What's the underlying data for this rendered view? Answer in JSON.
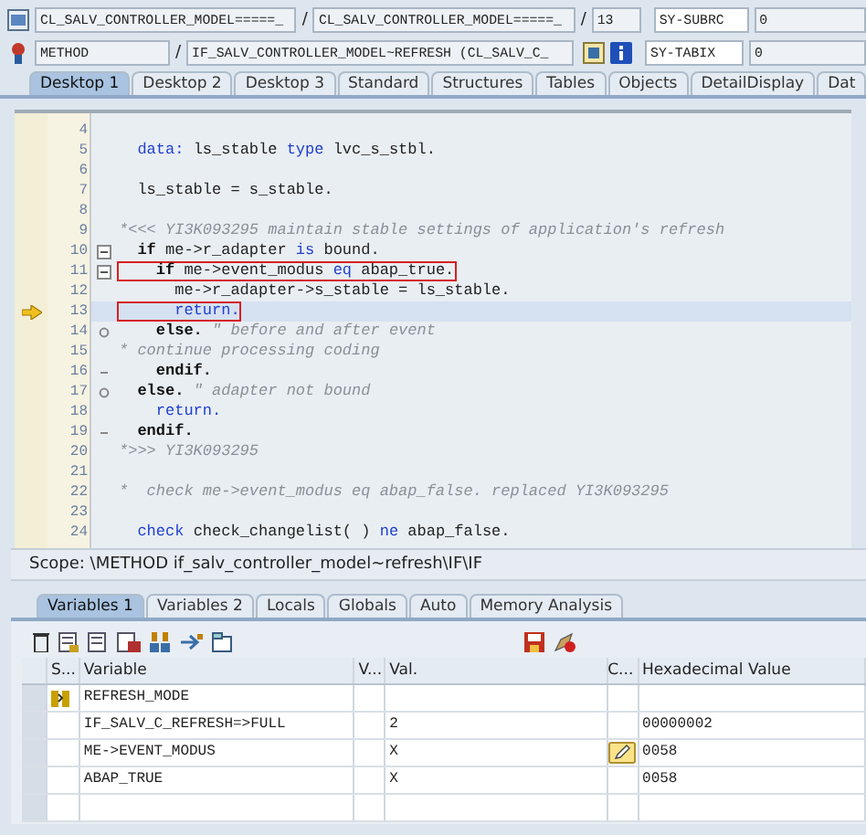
{
  "header": {
    "rows": [
      {
        "fields": [
          {
            "kind": "field",
            "value": "CL_SALV_CONTROLLER_MODEL=====_"
          },
          {
            "kind": "separator",
            "value": "/"
          },
          {
            "kind": "field",
            "value": "CL_SALV_CONTROLLER_MODEL=====_"
          },
          {
            "kind": "separator",
            "value": "/"
          },
          {
            "kind": "field",
            "value": "13"
          }
        ],
        "sys_field": "SY-SUBRC",
        "sys_value": "0",
        "tools": false
      },
      {
        "fields": [
          {
            "kind": "field",
            "value": "METHOD"
          },
          {
            "kind": "separator",
            "value": "/"
          },
          {
            "kind": "field",
            "value": "IF_SALV_CONTROLLER_MODEL~REFRESH (CL_SALV_C_"
          }
        ],
        "sys_field": "SY-TABIX",
        "sys_value": "0",
        "tools": true
      }
    ]
  },
  "tabs": [
    {
      "label": "Desktop 1",
      "selected": true
    },
    {
      "label": "Desktop 2",
      "selected": false
    },
    {
      "label": "Desktop 3",
      "selected": false
    },
    {
      "label": "Standard",
      "selected": false
    },
    {
      "label": "Structures",
      "selected": false
    },
    {
      "label": "Tables",
      "selected": false
    },
    {
      "label": "Objects",
      "selected": false
    },
    {
      "label": "DetailDisplay",
      "selected": false
    },
    {
      "label": "Dat",
      "selected": false
    }
  ],
  "code": {
    "lines": [
      {
        "number": "4",
        "current": false,
        "highlighted": false
      },
      {
        "number": "5",
        "current": false,
        "highlighted": false,
        "tokens": [
          {
            "kind": "keyword",
            "text": "  data:"
          },
          {
            "kind": "plain",
            "text": " ls_stable "
          },
          {
            "kind": "keyword",
            "text": "type"
          },
          {
            "kind": "plain",
            "text": " lvc_s_stbl."
          }
        ]
      },
      {
        "number": "6",
        "current": false,
        "highlighted": false
      },
      {
        "number": "7",
        "current": false,
        "highlighted": false,
        "tokens": [
          {
            "kind": "plain",
            "text": "  ls_stable = s_stable."
          }
        ]
      },
      {
        "number": "8",
        "current": false,
        "highlighted": false
      },
      {
        "number": "9",
        "current": false,
        "highlighted": false,
        "tokens": [
          {
            "kind": "comment",
            "text": "*<<< YI3K093295 maintain stable settings of application's refresh"
          }
        ]
      },
      {
        "number": "10",
        "current": false,
        "highlighted": false,
        "fold": {
          "kind": "box"
        },
        "tokens": [
          {
            "kind": "control",
            "text": "  if"
          },
          {
            "kind": "plain",
            "text": " me->r_adapter "
          },
          {
            "kind": "keyword",
            "text": "is"
          },
          {
            "kind": "plain",
            "text": " bound."
          }
        ]
      },
      {
        "number": "11",
        "current": false,
        "highlighted": true,
        "fold": {
          "kind": "box"
        },
        "tokens": [
          {
            "kind": "control",
            "text": "    if"
          },
          {
            "kind": "plain",
            "text": " me->event_modus "
          },
          {
            "kind": "keyword",
            "text": "eq"
          },
          {
            "kind": "plain",
            "text": " abap_true."
          }
        ]
      },
      {
        "number": "12",
        "current": false,
        "highlighted": false,
        "tokens": [
          {
            "kind": "plain",
            "text": "      me->r_adapter->s_stable = ls_stable."
          }
        ]
      },
      {
        "number": "13",
        "current": true,
        "highlighted": true,
        "tokens": [
          {
            "kind": "keyword",
            "text": "      return."
          }
        ]
      },
      {
        "number": "14",
        "current": false,
        "highlighted": false,
        "fold": {
          "kind": "dot"
        },
        "tokens": [
          {
            "kind": "control",
            "text": "    else."
          },
          {
            "kind": "comment",
            "text": " \" before and after event"
          }
        ]
      },
      {
        "number": "15",
        "current": false,
        "highlighted": false,
        "tokens": [
          {
            "kind": "comment",
            "text": "* continue processing coding"
          }
        ]
      },
      {
        "number": "16",
        "current": false,
        "highlighted": false,
        "fold": {
          "kind": "tick"
        },
        "tokens": [
          {
            "kind": "control",
            "text": "    endif."
          }
        ]
      },
      {
        "number": "17",
        "current": false,
        "highlighted": false,
        "fold": {
          "kind": "dot"
        },
        "tokens": [
          {
            "kind": "control",
            "text": "  else."
          },
          {
            "kind": "comment",
            "text": " \" adapter not bound"
          }
        ]
      },
      {
        "number": "18",
        "current": false,
        "highlighted": false,
        "tokens": [
          {
            "kind": "keyword",
            "text": "    return."
          }
        ]
      },
      {
        "number": "19",
        "current": false,
        "highlighted": false,
        "fold": {
          "kind": "tick"
        },
        "tokens": [
          {
            "kind": "control",
            "text": "  endif."
          }
        ]
      },
      {
        "number": "20",
        "current": false,
        "highlighted": false,
        "tokens": [
          {
            "kind": "comment",
            "text": "*>>> YI3K093295"
          }
        ]
      },
      {
        "number": "21",
        "current": false,
        "highlighted": false
      },
      {
        "number": "22",
        "current": false,
        "highlighted": false,
        "tokens": [
          {
            "kind": "comment",
            "text": "*  check me->event_modus eq abap_false. replaced YI3K093295"
          }
        ]
      },
      {
        "number": "23",
        "current": false,
        "highlighted": false
      },
      {
        "number": "24",
        "current": false,
        "highlighted": false,
        "tokens": [
          {
            "kind": "keyword",
            "text": "  check"
          },
          {
            "kind": "plain",
            "text": " check_changelist( ) "
          },
          {
            "kind": "keyword",
            "text": "ne"
          },
          {
            "kind": "plain",
            "text": " abap_false."
          }
        ]
      }
    ]
  },
  "scope": "Scope: \\METHOD if_salv_controller_model~refresh\\IF\\IF",
  "lower_tabs": [
    {
      "label": "Variables 1",
      "selected": true
    },
    {
      "label": "Variables 2",
      "selected": false
    },
    {
      "label": "Locals",
      "selected": false
    },
    {
      "label": "Globals",
      "selected": false
    },
    {
      "label": "Auto",
      "selected": false
    },
    {
      "label": "Memory Analysis",
      "selected": false
    }
  ],
  "table": {
    "columns": [
      "S...",
      "Variable",
      "V...",
      "Val.",
      "C...",
      "Hexadecimal Value"
    ],
    "rows": [
      {
        "status_icon": true,
        "variable": "REFRESH_MODE",
        "edit": false
      },
      {
        "status_icon": false,
        "variable": "IF_SALV_C_REFRESH=>FULL",
        "value": "2",
        "edit": false,
        "hex": "00000002"
      },
      {
        "status_icon": false,
        "variable": "ME->EVENT_MODUS",
        "value": "X",
        "edit": true,
        "hex": "0058"
      },
      {
        "status_icon": false,
        "variable": "ABAP_TRUE",
        "value": "X",
        "edit": false,
        "hex": "0058"
      }
    ]
  }
}
